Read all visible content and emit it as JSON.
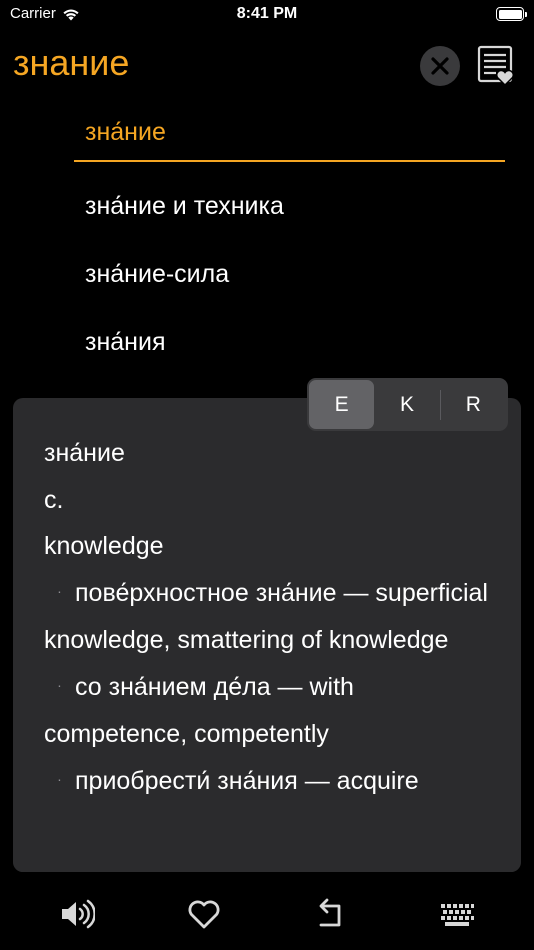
{
  "status_bar": {
    "carrier": "Carrier",
    "time": "8:41 PM",
    "battery_level": 1.0
  },
  "header": {
    "search_text": "знание",
    "clear_icon": "close-icon",
    "favorites_list_icon": "list-heart-icon"
  },
  "suggestions": [
    {
      "text": "зна́ние",
      "active": true
    },
    {
      "text": "зна́ние и техника",
      "active": false
    },
    {
      "text": "зна́ние-сила",
      "active": false
    },
    {
      "text": "зна́ния",
      "active": false
    }
  ],
  "language_tabs": [
    {
      "label": "E",
      "selected": true
    },
    {
      "label": "K",
      "selected": false
    },
    {
      "label": "R",
      "selected": false
    }
  ],
  "definition": {
    "headword": "зна́ние",
    "grammar": "с.",
    "translation": "knowledge",
    "examples": [
      {
        "bullet": "·",
        "phrase": "пове́рхностное зна́ние — superficial knowledge, smattering of knowledge"
      },
      {
        "bullet": "·",
        "phrase": "со зна́нием де́ла — with competence, competently"
      },
      {
        "bullet": "·",
        "phrase": "приобрести́ зна́ния — acquire"
      }
    ]
  },
  "toolbar": {
    "icons": [
      "speaker-icon",
      "heart-icon",
      "back-arrow-icon",
      "keyboard-icon"
    ]
  },
  "colors": {
    "accent": "#F5A623",
    "background": "#000000",
    "card": "#2B2B2D"
  }
}
